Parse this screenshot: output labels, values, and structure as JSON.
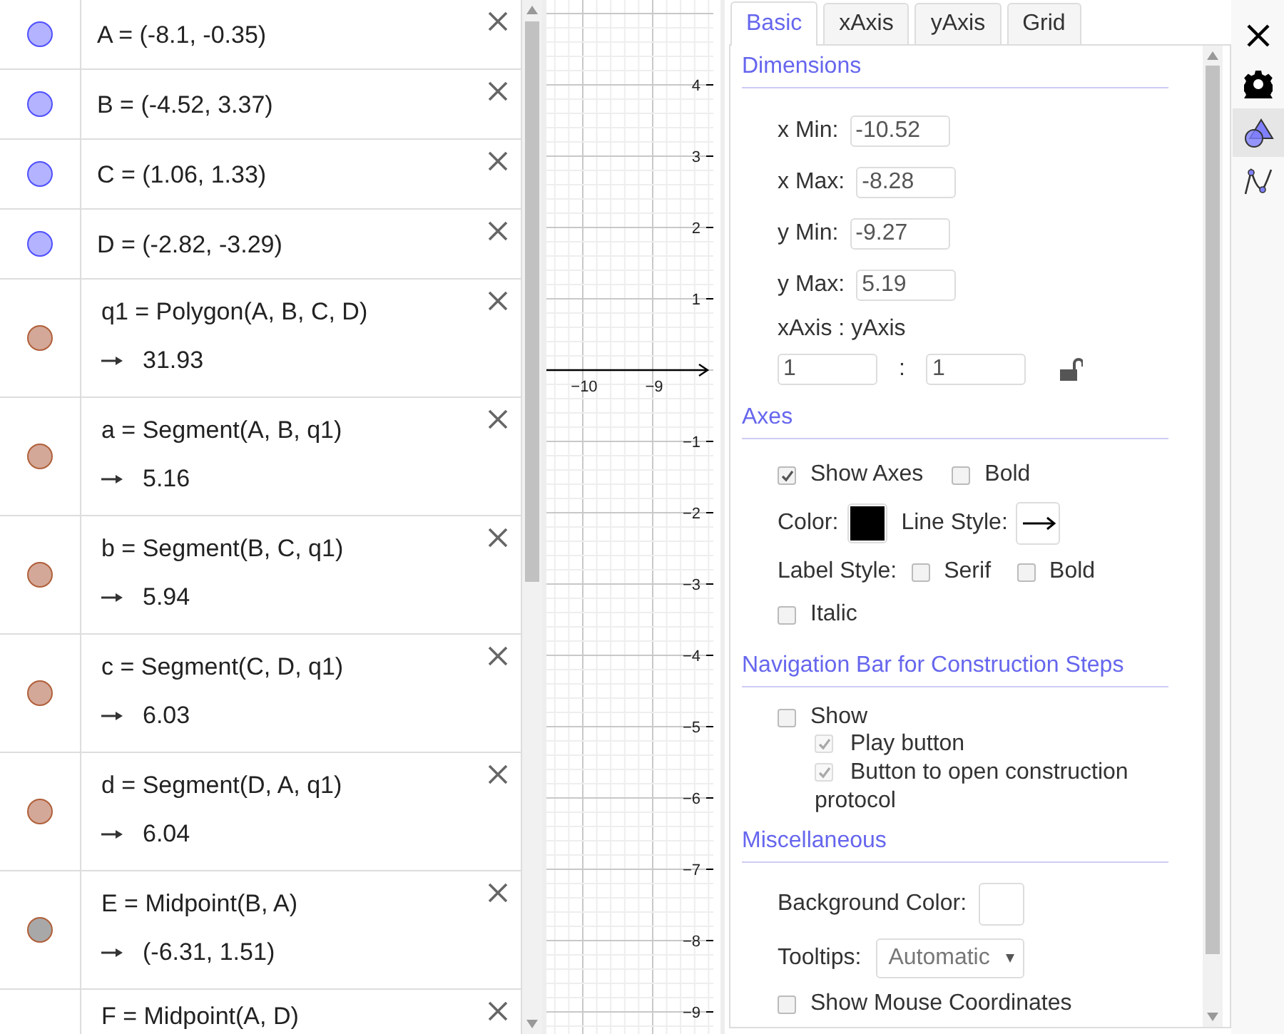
{
  "algebra": {
    "items": [
      {
        "kind": "point",
        "color": "#b3b3ff",
        "definition": "A = (-8.1, -0.35)"
      },
      {
        "kind": "point",
        "color": "#b3b3ff",
        "definition": "B = (-4.52, 3.37)"
      },
      {
        "kind": "point",
        "color": "#b3b3ff",
        "definition": "C = (1.06, 1.33)"
      },
      {
        "kind": "point",
        "color": "#b3b3ff",
        "definition": "D = (-2.82, -3.29)"
      },
      {
        "kind": "dependent",
        "color": "#d4a898",
        "definition": "q1 = Polygon(A, B, C, D)",
        "value": "31.93"
      },
      {
        "kind": "dependent",
        "color": "#d4a898",
        "definition": "a = Segment(A, B, q1)",
        "value": "5.16"
      },
      {
        "kind": "dependent",
        "color": "#d4a898",
        "definition": "b = Segment(B, C, q1)",
        "value": "5.94"
      },
      {
        "kind": "dependent",
        "color": "#d4a898",
        "definition": "c = Segment(C, D, q1)",
        "value": "6.03"
      },
      {
        "kind": "dependent",
        "color": "#d4a898",
        "definition": "d = Segment(D, A, q1)",
        "value": "6.04"
      },
      {
        "kind": "dependent",
        "color": "#a8a8a8",
        "definition": "E = Midpoint(B, A)",
        "value": "(-6.31, 1.51)"
      },
      {
        "kind": "cut",
        "definition": "F = Midpoint(A, D)"
      }
    ]
  },
  "graphics": {
    "x_labels": [
      "−10",
      "−9"
    ],
    "y_labels_above": [
      "4",
      "3",
      "2",
      "1"
    ],
    "y_labels_below": [
      "−1",
      "−2",
      "−3",
      "−4",
      "−5",
      "−6",
      "−7",
      "−8",
      "−9"
    ]
  },
  "settings": {
    "tabs": [
      {
        "label": "Basic",
        "selected": true
      },
      {
        "label": "xAxis",
        "selected": false
      },
      {
        "label": "yAxis",
        "selected": false
      },
      {
        "label": "Grid",
        "selected": false
      }
    ],
    "dimensions": {
      "title": "Dimensions",
      "fields": [
        {
          "label": "x Min:",
          "value": "-10.52"
        },
        {
          "label": "x Max:",
          "value": "-8.28"
        },
        {
          "label": "y Min:",
          "value": "-9.27"
        },
        {
          "label": "y Max:",
          "value": "5.19"
        }
      ],
      "ratio_label": "xAxis : yAxis",
      "ratio": [
        "1",
        "1"
      ],
      "separator": ":",
      "locked": false
    },
    "axes": {
      "title": "Axes",
      "show_axes": {
        "label": "Show Axes",
        "checked": true
      },
      "bold": {
        "label": "Bold",
        "checked": false
      },
      "color_label": "Color:",
      "color": "#000000",
      "line_style_label": "Line Style:",
      "label_style_label": "Label Style:",
      "label_style": [
        {
          "label": "Serif",
          "checked": false
        },
        {
          "label": "Bold",
          "checked": false
        },
        {
          "label": "Italic",
          "checked": false
        }
      ]
    },
    "navigation": {
      "title": "Navigation Bar for Construction Steps",
      "show": {
        "label": "Show",
        "checked": false
      },
      "options": [
        {
          "label": "Play button",
          "checked": true,
          "disabled": true
        },
        {
          "label": "Button to open construction protocol",
          "checked": true,
          "disabled": true
        }
      ]
    },
    "misc": {
      "title": "Miscellaneous",
      "background_label": "Background Color:",
      "tooltips_label": "Tooltips:",
      "tooltips_value": "Automatic",
      "mouse_coords": {
        "label": "Show Mouse Coordinates",
        "checked": false
      }
    }
  }
}
